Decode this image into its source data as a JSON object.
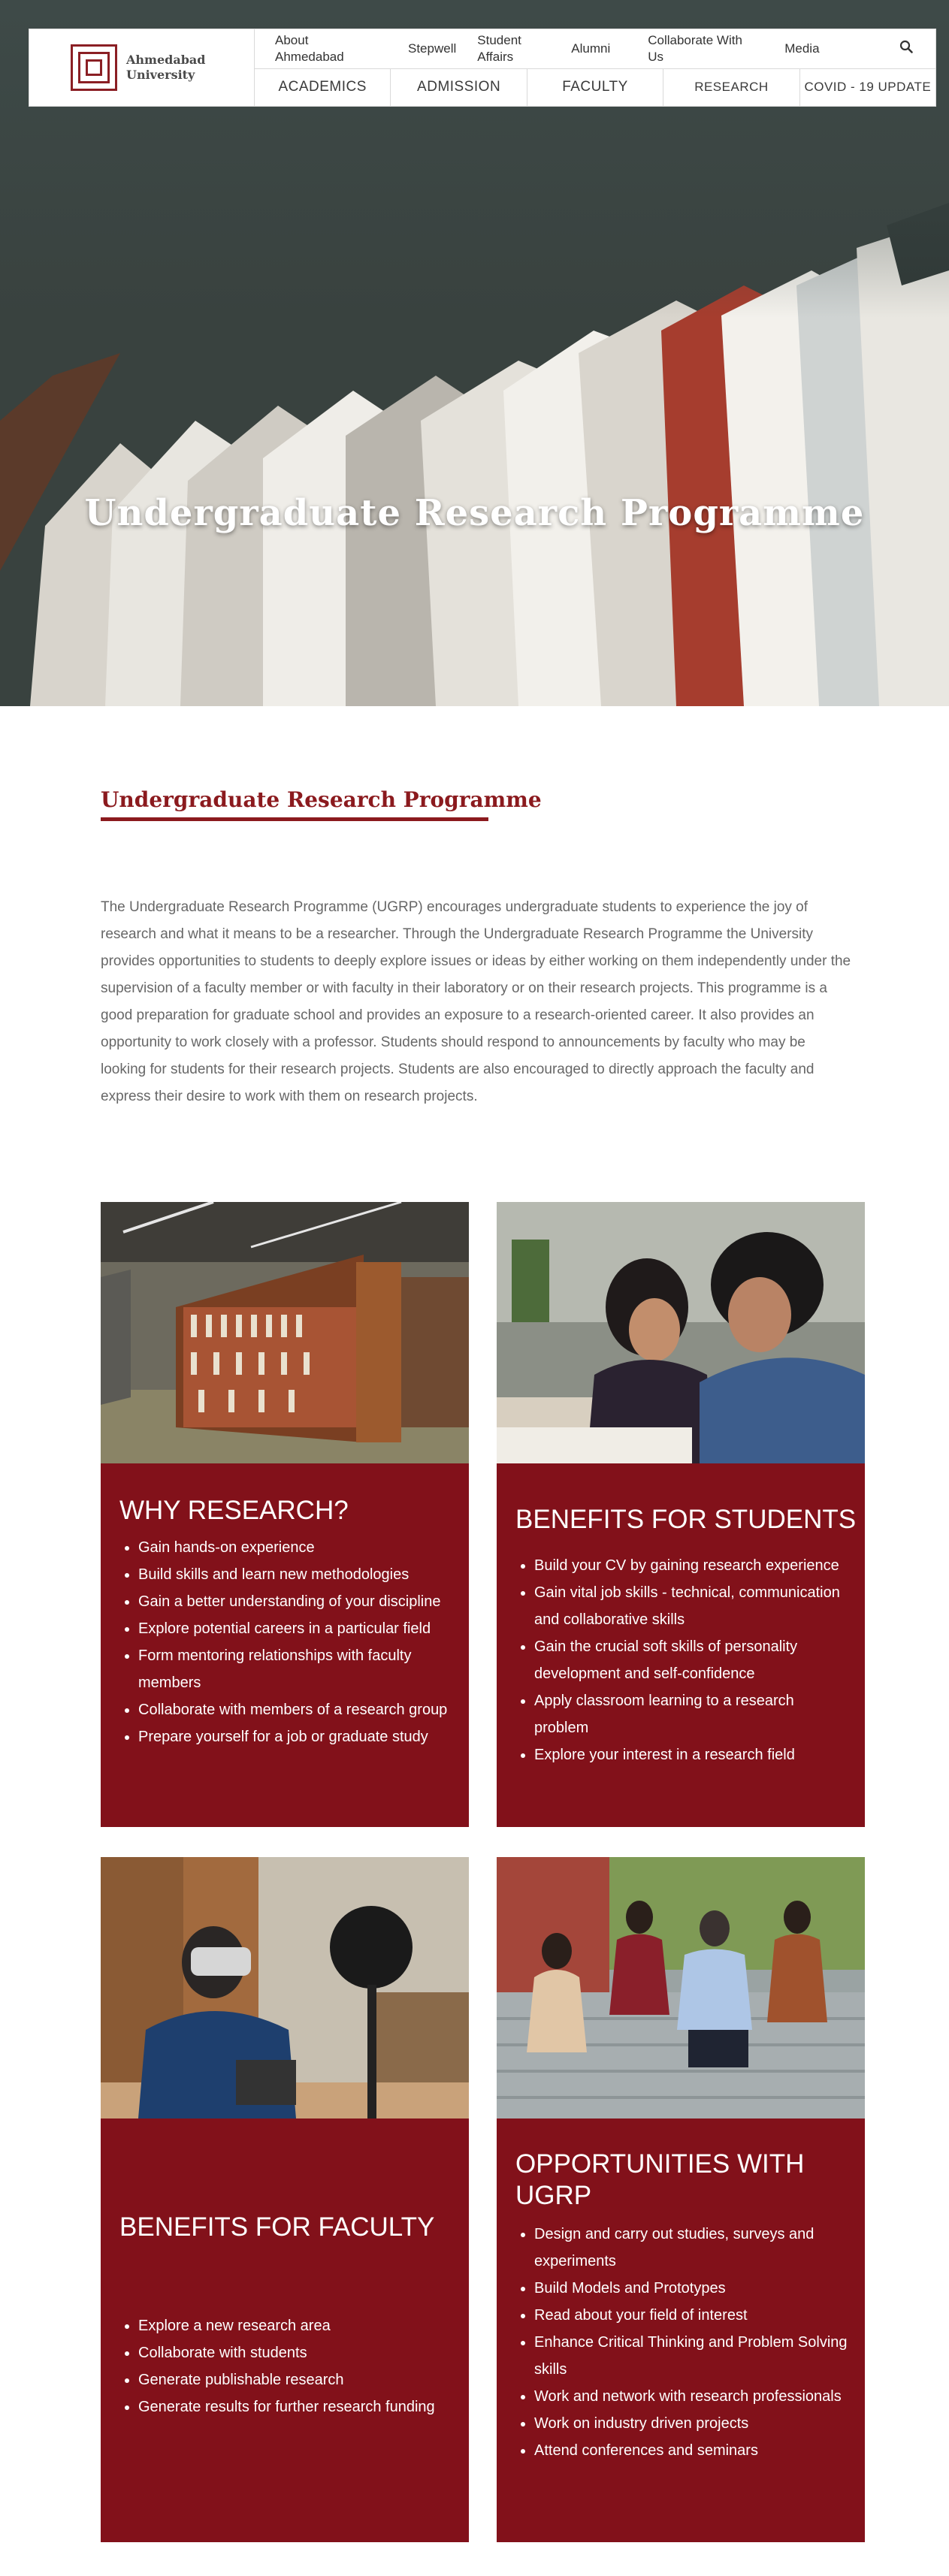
{
  "header": {
    "logo_line1": "Ahmedabad",
    "logo_line2": "University",
    "top_links": [
      "About Ahmedabad",
      "Stepwell",
      "Student Affairs",
      "Alumni",
      "Collaborate With Us",
      "Media"
    ],
    "main_links": [
      "ACADEMICS",
      "ADMISSION",
      "FACULTY",
      "RESEARCH",
      "COVID - 19 UPDATE"
    ]
  },
  "hero": {
    "title": "Undergraduate Research Programme"
  },
  "intro": {
    "title": "Undergraduate Research Programme",
    "text": "The Undergraduate Research Programme (UGRP)  encourages undergraduate students to experience the joy of research and what it means to be a researcher. Through the Undergraduate Research Programme the University provides opportunities to students to deeply explore issues or ideas by either working on them independently under the supervision of a faculty member or with faculty in their laboratory or on their research projects. This programme is a good preparation for graduate school and provides an exposure to a research-oriented career. It also provides an opportunity to work closely with a professor. Students should respond to announcements by faculty who may be looking for students for their research projects. Students are also encouraged to directly approach the faculty and express their desire to work with them on research projects."
  },
  "cards": [
    {
      "title": "WHY RESEARCH?",
      "items": [
        "Gain hands-on experience",
        "Build skills and learn new methodologies",
        "Gain a better understanding of your discipline",
        "Explore potential careers in a particular field",
        "Form mentoring relationships with faculty members",
        "Collaborate with members of a research group",
        "Prepare yourself for a job or graduate study"
      ]
    },
    {
      "title": "BENEFITS FOR STUDENTS",
      "items": [
        "Build your CV by gaining research experience",
        "Gain vital job skills - technical, communication and collaborative skills",
        "Gain the crucial soft skills of personality development and self-confidence",
        "Apply classroom learning to a research problem",
        "Explore your interest in a research field"
      ]
    },
    {
      "title": "BENEFITS FOR FACULTY",
      "items": [
        "Explore a new research area",
        "Collaborate with students",
        "Generate publishable research",
        "Generate results for further research funding"
      ]
    },
    {
      "title": "OPPORTUNITIES WITH UGRP",
      "items": [
        "Design and carry out studies, surveys and experiments",
        "Build Models and Prototypes",
        "Read about your field of interest",
        "Enhance Critical Thinking and Problem Solving skills",
        "Work and network with research professionals",
        "Work on industry driven projects",
        "Attend conferences and seminars"
      ]
    }
  ],
  "colors": {
    "maroon": "#82111a",
    "title_red": "#8b1a1e"
  }
}
